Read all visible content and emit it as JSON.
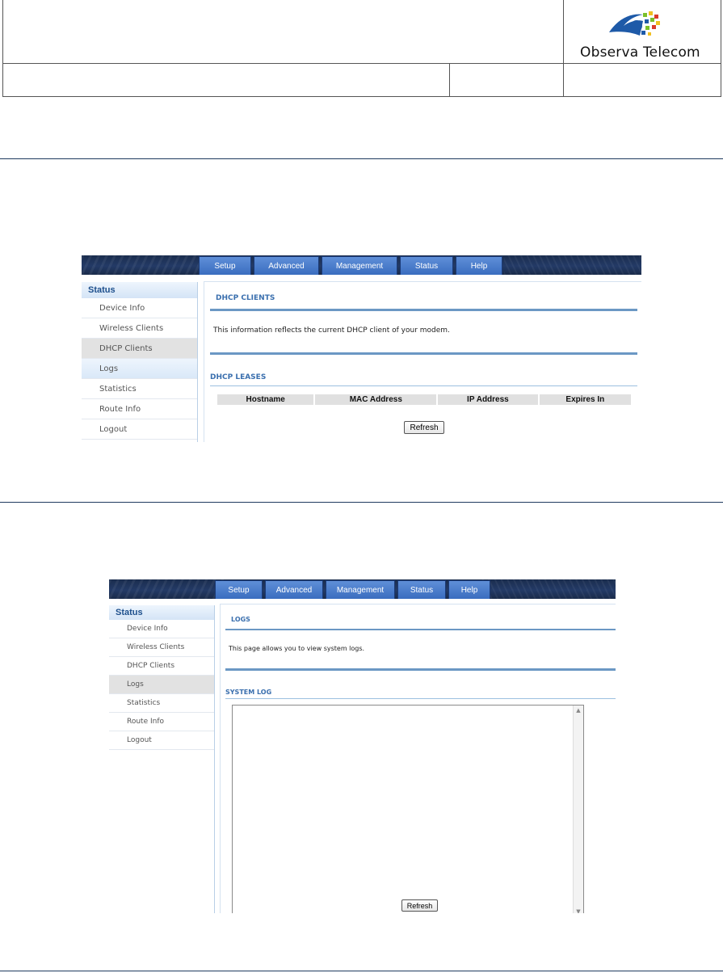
{
  "header": {
    "logo_text": "Observa Telecom",
    "logo_colors": [
      "#1e5aa8",
      "#7bbf2a",
      "#f0c020",
      "#d93a2b"
    ]
  },
  "shot1": {
    "nav_tabs": [
      "Setup",
      "Advanced",
      "Management",
      "Status",
      "Help"
    ],
    "sidebar": {
      "title": "Status",
      "items": [
        "Device Info",
        "Wireless Clients",
        "DHCP Clients",
        "Logs",
        "Statistics",
        "Route Info",
        "Logout"
      ],
      "active": "DHCP Clients"
    },
    "section_title": "DHCP CLIENTS",
    "description": "This information reflects the current DHCP client of your modem.",
    "subsection_title": "DHCP LEASES",
    "table_headers": [
      "Hostname",
      "MAC Address",
      "IP Address",
      "Expires In"
    ],
    "refresh_label": "Refresh"
  },
  "shot2": {
    "nav_tabs": [
      "Setup",
      "Advanced",
      "Management",
      "Status",
      "Help"
    ],
    "sidebar": {
      "title": "Status",
      "items": [
        "Device Info",
        "Wireless Clients",
        "DHCP Clients",
        "Logs",
        "Statistics",
        "Route Info",
        "Logout"
      ],
      "active": "Logs"
    },
    "section_title": "LOGS",
    "description": "This page allows you to view system logs.",
    "subsection_title": "SYSTEM LOG",
    "log_content": "",
    "refresh_label": "Refresh"
  }
}
